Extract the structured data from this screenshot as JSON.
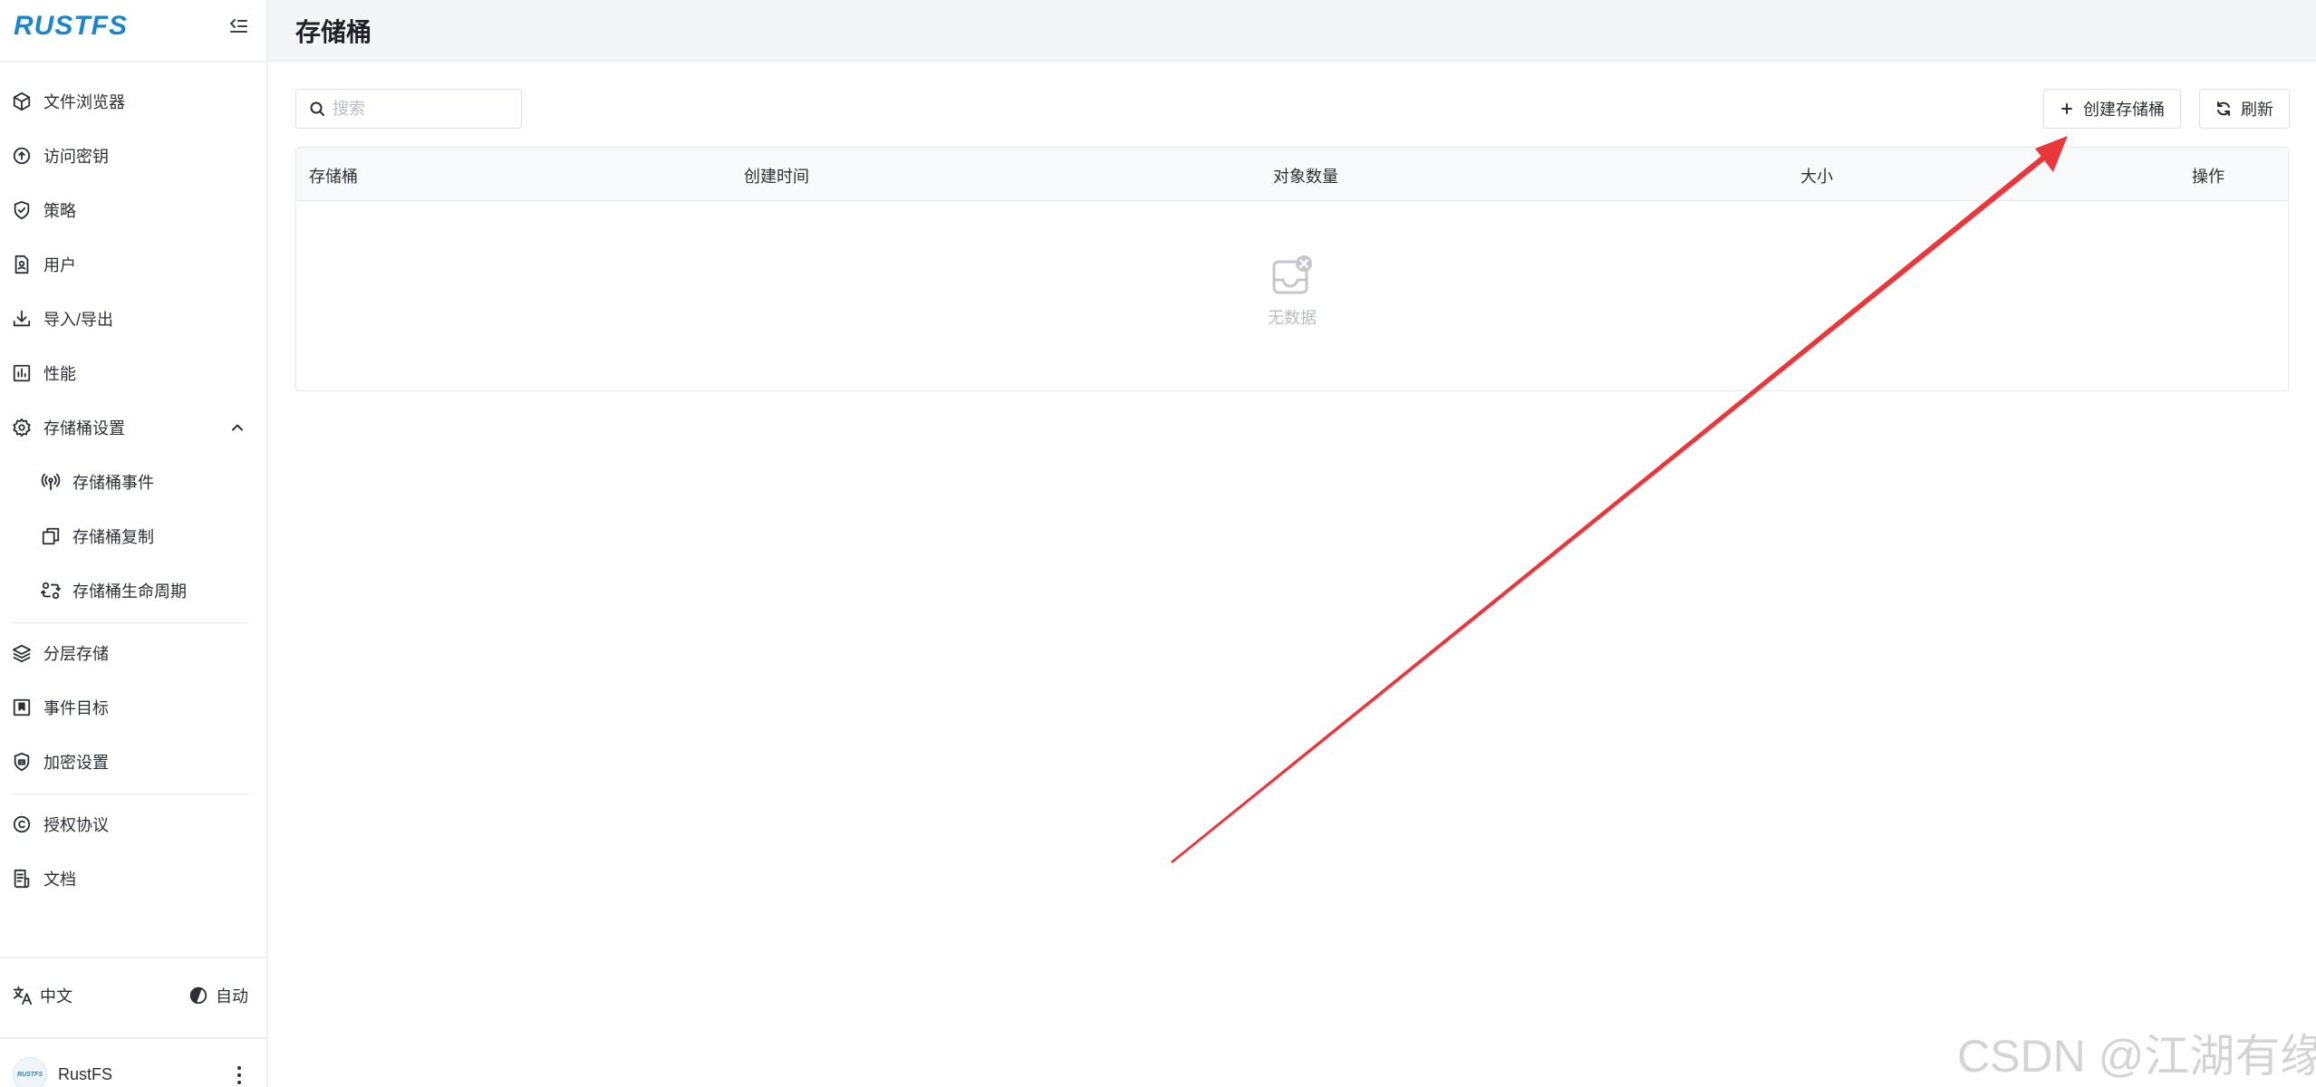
{
  "brand": {
    "name": "RUSTFS",
    "color": "#1a86c9"
  },
  "sidebar": {
    "items": [
      {
        "label": "文件浏览器",
        "icon": "box-icon"
      },
      {
        "label": "访问密钥",
        "icon": "key-circle-icon"
      },
      {
        "label": "策略",
        "icon": "shield-check-icon"
      },
      {
        "label": "用户",
        "icon": "user-file-icon"
      },
      {
        "label": "导入/导出",
        "icon": "download-icon"
      },
      {
        "label": "性能",
        "icon": "bar-chart-icon"
      },
      {
        "label": "存储桶设置",
        "icon": "gear-icon",
        "expanded": true
      },
      {
        "label": "存储桶事件",
        "icon": "broadcast-icon",
        "sub": true
      },
      {
        "label": "存储桶复制",
        "icon": "copy-icon",
        "sub": true
      },
      {
        "label": "存储桶生命周期",
        "icon": "lifecycle-icon",
        "sub": true
      },
      {
        "label": "分层存储",
        "icon": "layers-icon"
      },
      {
        "label": "事件目标",
        "icon": "bookmark-icon"
      },
      {
        "label": "加密设置",
        "icon": "encryption-icon"
      },
      {
        "label": "授权协议",
        "icon": "copyright-icon"
      },
      {
        "label": "文档",
        "icon": "document-icon"
      }
    ],
    "language": "中文",
    "theme": "自动",
    "user": {
      "name": "RustFS",
      "avatar_text": "RUSTFS"
    }
  },
  "header": {
    "title": "存储桶"
  },
  "toolbar": {
    "search_placeholder": "搜索",
    "create_label": "创建存储桶",
    "refresh_label": "刷新"
  },
  "table": {
    "columns": [
      "存储桶",
      "创建时间",
      "对象数量",
      "大小",
      "操作"
    ],
    "rows": [],
    "empty_text": "无数据"
  },
  "annotation": {
    "arrow_color": "#e8383b"
  },
  "watermark": "CSDN @江湖有缘"
}
